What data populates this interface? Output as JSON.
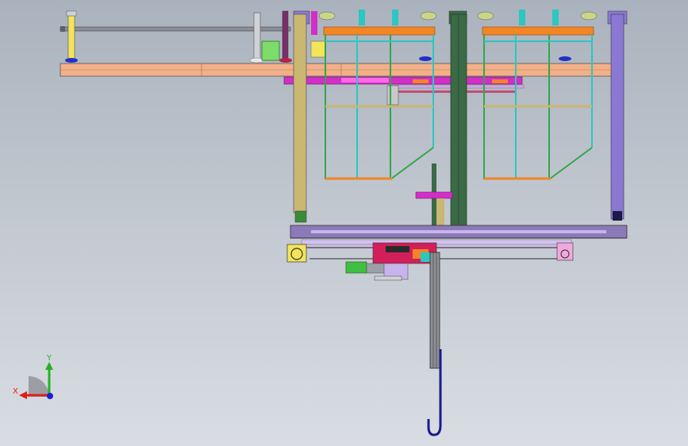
{
  "viewport": {
    "background_top": "#aab2bd",
    "background_bottom": "#d9dde3"
  },
  "triad": {
    "x_label": "X",
    "y_label": "Y",
    "x_color": "#e0201b",
    "y_color": "#22b41f",
    "z_color": "#1d1dd8"
  },
  "palette": {
    "beam": "#f2b088",
    "column_left": "#c9b772",
    "column_center": "#3a6a46",
    "column_right": "#8a78d4",
    "frame": "#33a64d",
    "frame_cyan": "#2cc7c0",
    "rail": "#c8b4ec",
    "lower_beam": "#8c79b8",
    "magenta": "#d42ec8",
    "orange": "#f28524",
    "yellow": "#f4e45a",
    "hook": "#1a1a8c"
  }
}
